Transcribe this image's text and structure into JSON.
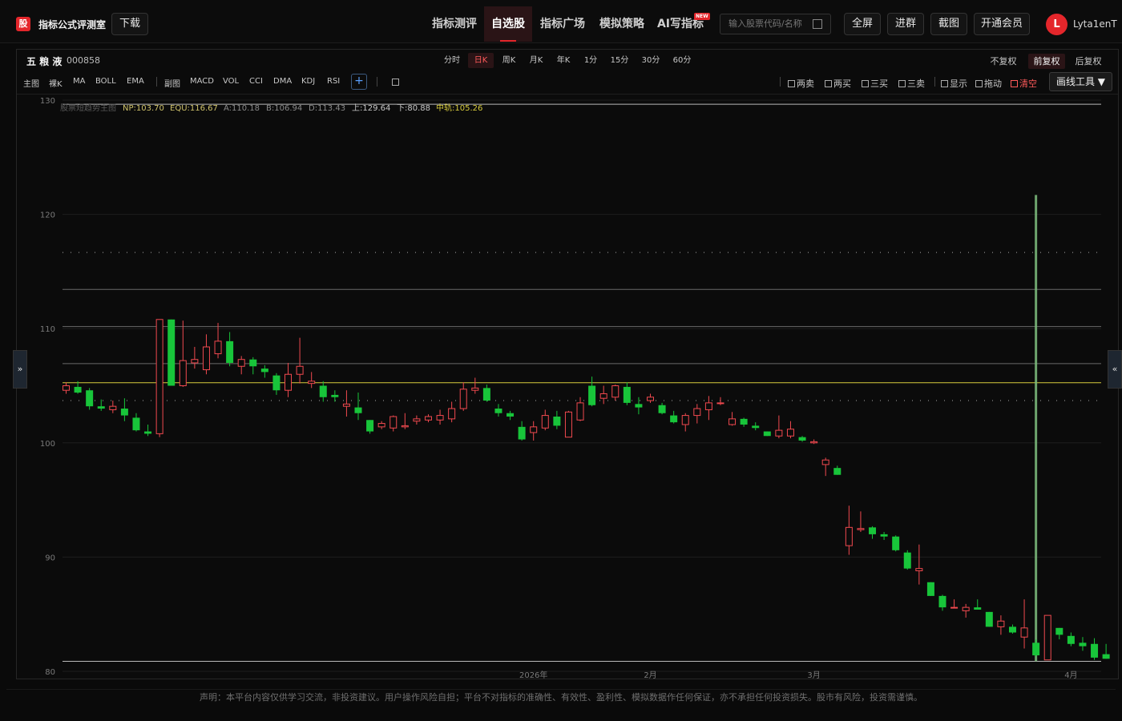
{
  "app": {
    "logo_char": "股",
    "title": "指标公式评测室",
    "download": "下载"
  },
  "nav": [
    {
      "label": "指标测评",
      "active": false
    },
    {
      "label": "自选股",
      "active": true
    },
    {
      "label": "指标广场",
      "active": false
    },
    {
      "label": "模拟策略",
      "active": false
    },
    {
      "label": "AI写指标",
      "active": false
    }
  ],
  "new_badge": "NEW",
  "search": {
    "placeholder": "输入股票代码/名称"
  },
  "actions": [
    "全屏",
    "进群",
    "截图",
    "开通会员"
  ],
  "user": {
    "initial": "L",
    "name": "Lyta1enT"
  },
  "stock": {
    "name": "五 粮 液",
    "code": "000858"
  },
  "periods": [
    "分时",
    "日K",
    "周K",
    "月K",
    "年K",
    "1分",
    "15分",
    "30分",
    "60分"
  ],
  "active_period": "日K",
  "adjust": [
    "不复权",
    "前复权",
    "后复权"
  ],
  "active_adjust": "前复权",
  "main_indicators": [
    "主图",
    "裸K",
    "MA",
    "BOLL",
    "EMA"
  ],
  "sub_indicators": [
    "副图",
    "MACD",
    "VOL",
    "CCI",
    "DMA",
    "KDJ",
    "RSI"
  ],
  "add_label": "+",
  "signal_toggles": [
    {
      "label": "两卖",
      "red": false
    },
    {
      "label": "两买",
      "red": false
    },
    {
      "label": "三买",
      "red": false
    },
    {
      "label": "三卖",
      "red": false
    }
  ],
  "view_toggles": [
    {
      "label": "显示",
      "red": false
    },
    {
      "label": "拖动",
      "red": false
    },
    {
      "label": "清空",
      "red": true
    }
  ],
  "draw_tool": "画线工具",
  "draw_tool_arrow": "▼",
  "legend": {
    "name": "股票短趋势主图",
    "np": "NP:103.70",
    "equ": "EQU:116.67",
    "a": "A:110.18",
    "b": "B:106.94",
    "d": "D:113.43",
    "up": "上:129.64",
    "down": "下:80.88",
    "mid": "中轨:105.26"
  },
  "side_left": "»",
  "side_right": "«",
  "disclaimer": "声明：本平台内容仅供学习交流，非投资建议。用户操作风险自担；平台不对指标的准确性、有效性、盈利性、模拟数据作任何保证，亦不承担任何投资损失。股市有风险，投资需谨慎。",
  "chart_data": {
    "type": "candlestick",
    "ylim": [
      80,
      130
    ],
    "y_ticks": [
      80,
      90,
      100,
      110,
      120,
      130
    ],
    "x_labels": [
      "2026年",
      "2月",
      "3月",
      "4月"
    ],
    "x_label_index": [
      40,
      50,
      64,
      86
    ],
    "colors": {
      "up": "#f0494f",
      "down": "#18c53a",
      "mid": "#d8cc3c",
      "vline": "#7fbf7f"
    },
    "levels": {
      "top": 129.64,
      "equ": 116.67,
      "d": 113.43,
      "a": 110.18,
      "b": 106.94,
      "mid": 105.26,
      "np": 103.7,
      "bottom": 80.88
    },
    "vertical_marker_index": 83,
    "candles": [
      [
        104.6,
        105.3,
        104.3,
        105.0
      ],
      [
        104.9,
        105.4,
        104.3,
        104.4
      ],
      [
        104.6,
        104.8,
        102.9,
        103.2
      ],
      [
        103.2,
        103.8,
        102.8,
        103.0
      ],
      [
        102.9,
        103.7,
        102.6,
        103.2
      ],
      [
        103.0,
        103.9,
        101.9,
        102.4
      ],
      [
        102.2,
        102.6,
        101.0,
        101.1
      ],
      [
        101.0,
        101.6,
        100.6,
        100.8
      ],
      [
        100.8,
        110.8,
        100.5,
        110.8
      ],
      [
        110.8,
        110.8,
        105.0,
        105.0
      ],
      [
        105.0,
        110.7,
        104.9,
        107.2
      ],
      [
        107.0,
        108.4,
        106.5,
        107.3
      ],
      [
        106.4,
        109.5,
        106.0,
        108.4
      ],
      [
        107.8,
        110.5,
        107.4,
        108.9
      ],
      [
        108.9,
        109.7,
        106.7,
        107.0
      ],
      [
        106.7,
        107.6,
        106.0,
        107.3
      ],
      [
        107.3,
        107.5,
        106.0,
        106.7
      ],
      [
        106.5,
        106.8,
        105.7,
        106.2
      ],
      [
        105.9,
        106.1,
        104.2,
        104.6
      ],
      [
        104.6,
        107.0,
        104.0,
        106.0
      ],
      [
        106.0,
        109.2,
        105.2,
        106.7
      ],
      [
        105.2,
        106.2,
        104.8,
        105.4
      ],
      [
        105.0,
        105.4,
        103.6,
        104.0
      ],
      [
        104.2,
        104.6,
        103.6,
        104.0
      ],
      [
        103.2,
        104.6,
        102.3,
        103.4
      ],
      [
        103.1,
        104.4,
        102.0,
        102.6
      ],
      [
        102.0,
        102.0,
        100.8,
        101.0
      ],
      [
        101.4,
        101.9,
        101.2,
        101.7
      ],
      [
        101.3,
        102.4,
        101.0,
        102.3
      ],
      [
        101.4,
        102.6,
        101.2,
        101.5
      ],
      [
        101.9,
        102.4,
        101.6,
        102.1
      ],
      [
        102.0,
        102.5,
        101.8,
        102.3
      ],
      [
        102.0,
        102.9,
        101.6,
        102.4
      ],
      [
        102.1,
        103.6,
        101.8,
        103.0
      ],
      [
        103.0,
        105.3,
        102.8,
        104.7
      ],
      [
        104.6,
        105.7,
        104.3,
        104.8
      ],
      [
        104.8,
        105.1,
        103.6,
        103.7
      ],
      [
        103.0,
        103.4,
        102.3,
        102.6
      ],
      [
        102.6,
        102.8,
        102.0,
        102.3
      ],
      [
        101.4,
        101.9,
        100.2,
        100.3
      ],
      [
        100.9,
        101.9,
        100.2,
        101.4
      ],
      [
        101.3,
        102.9,
        101.1,
        102.4
      ],
      [
        102.3,
        102.8,
        101.2,
        101.5
      ],
      [
        100.5,
        102.8,
        100.5,
        102.7
      ],
      [
        102.0,
        104.0,
        101.9,
        103.5
      ],
      [
        105.0,
        105.8,
        103.2,
        103.3
      ],
      [
        103.9,
        105.0,
        103.4,
        104.3
      ],
      [
        104.0,
        105.1,
        103.7,
        105.0
      ],
      [
        104.9,
        105.3,
        103.3,
        103.5
      ],
      [
        103.4,
        104.0,
        102.5,
        103.1
      ],
      [
        103.7,
        104.3,
        103.5,
        104.0
      ],
      [
        103.3,
        103.5,
        102.5,
        102.6
      ],
      [
        102.4,
        102.8,
        101.7,
        101.8
      ],
      [
        101.6,
        102.6,
        101.0,
        102.4
      ],
      [
        102.4,
        103.4,
        101.7,
        103.0
      ],
      [
        102.9,
        104.1,
        102.0,
        103.5
      ],
      [
        103.5,
        104.0,
        103.3,
        103.5
      ],
      [
        101.6,
        102.7,
        101.5,
        102.1
      ],
      [
        102.1,
        102.2,
        101.4,
        101.6
      ],
      [
        101.5,
        101.8,
        101.1,
        101.3
      ],
      [
        101.0,
        101.0,
        100.6,
        100.6
      ],
      [
        100.6,
        102.4,
        100.4,
        101.1
      ],
      [
        100.6,
        101.9,
        100.4,
        101.2
      ],
      [
        100.5,
        100.6,
        100.1,
        100.2
      ],
      [
        100.0,
        100.3,
        99.9,
        100.1
      ],
      [
        98.1,
        98.7,
        97.1,
        98.5
      ],
      [
        97.8,
        98.0,
        97.2,
        97.2
      ],
      [
        91.0,
        94.5,
        90.2,
        92.6
      ],
      [
        92.4,
        94.0,
        92.2,
        92.5
      ],
      [
        92.6,
        92.7,
        91.6,
        92.0
      ],
      [
        92.0,
        92.2,
        91.5,
        91.8
      ],
      [
        91.8,
        91.9,
        90.5,
        90.6
      ],
      [
        90.4,
        90.6,
        88.9,
        89.0
      ],
      [
        88.8,
        91.1,
        87.6,
        89.0
      ],
      [
        87.8,
        87.8,
        86.6,
        86.6
      ],
      [
        86.6,
        86.7,
        85.3,
        85.6
      ],
      [
        85.6,
        86.3,
        85.6,
        85.6
      ],
      [
        85.3,
        85.9,
        84.7,
        85.6
      ],
      [
        85.6,
        86.3,
        85.5,
        85.4
      ],
      [
        85.2,
        85.2,
        83.9,
        83.9
      ],
      [
        83.9,
        84.9,
        83.2,
        84.4
      ],
      [
        83.9,
        84.1,
        83.3,
        83.4
      ],
      [
        83.0,
        86.3,
        82.0,
        83.8
      ],
      [
        82.5,
        82.8,
        81.3,
        81.4
      ],
      [
        81.0,
        84.9,
        81.0,
        84.9
      ],
      [
        83.8,
        83.8,
        82.8,
        83.2
      ],
      [
        83.1,
        83.4,
        82.2,
        82.4
      ],
      [
        82.5,
        83.0,
        81.8,
        82.2
      ],
      [
        82.4,
        82.9,
        81.0,
        81.2
      ],
      [
        81.5,
        82.4,
        81.1,
        81.1
      ]
    ]
  }
}
